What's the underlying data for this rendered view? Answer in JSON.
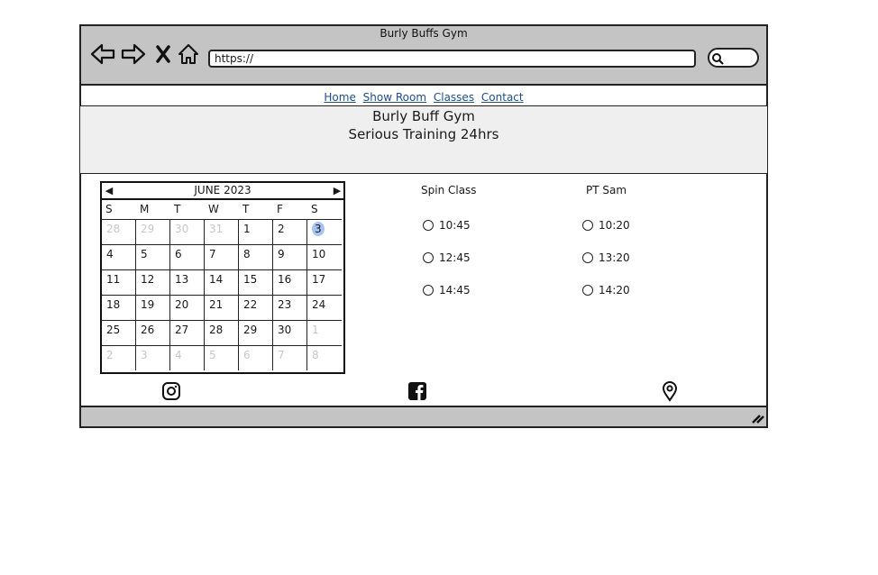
{
  "window": {
    "title": "Burly Buffs Gym"
  },
  "address_bar": {
    "value": "https://"
  },
  "nav": {
    "links": [
      "Home",
      "Show Room",
      "Classes",
      "Contact"
    ]
  },
  "hero": {
    "title": "Burly Buff Gym",
    "subtitle": "Serious Training 24hrs"
  },
  "calendar": {
    "month_label": "JUNE 2023",
    "weekdays": [
      "S",
      "M",
      "T",
      "W",
      "T",
      "F",
      "S"
    ],
    "selected_day": "3",
    "weeks": [
      [
        {
          "d": "28",
          "dim": true
        },
        {
          "d": "29",
          "dim": true
        },
        {
          "d": "30",
          "dim": true
        },
        {
          "d": "31",
          "dim": true
        },
        {
          "d": "1",
          "dim": false
        },
        {
          "d": "2",
          "dim": false
        },
        {
          "d": "3",
          "dim": false,
          "sel": true
        }
      ],
      [
        {
          "d": "4"
        },
        {
          "d": "5"
        },
        {
          "d": "6"
        },
        {
          "d": "7"
        },
        {
          "d": "8"
        },
        {
          "d": "9"
        },
        {
          "d": "10"
        }
      ],
      [
        {
          "d": "11"
        },
        {
          "d": "12"
        },
        {
          "d": "13"
        },
        {
          "d": "14"
        },
        {
          "d": "15"
        },
        {
          "d": "16"
        },
        {
          "d": "17"
        }
      ],
      [
        {
          "d": "18"
        },
        {
          "d": "19"
        },
        {
          "d": "20"
        },
        {
          "d": "21"
        },
        {
          "d": "22"
        },
        {
          "d": "23"
        },
        {
          "d": "24"
        }
      ],
      [
        {
          "d": "25"
        },
        {
          "d": "26"
        },
        {
          "d": "27"
        },
        {
          "d": "28"
        },
        {
          "d": "29"
        },
        {
          "d": "30"
        },
        {
          "d": "1",
          "dim": true
        }
      ],
      [
        {
          "d": "2",
          "dim": true
        },
        {
          "d": "3",
          "dim": true
        },
        {
          "d": "4",
          "dim": true
        },
        {
          "d": "5",
          "dim": true
        },
        {
          "d": "6",
          "dim": true
        },
        {
          "d": "7",
          "dim": true
        },
        {
          "d": "8",
          "dim": true
        }
      ]
    ]
  },
  "classes": [
    {
      "name": "Spin Class",
      "times": [
        "10:45",
        "12:45",
        "14:45"
      ]
    },
    {
      "name": "PT Sam",
      "times": [
        "10:20",
        "13:20",
        "14:20"
      ]
    }
  ],
  "footer": {
    "icons": [
      "instagram-icon",
      "facebook-icon",
      "location-pin-icon"
    ]
  },
  "colors": {
    "chrome": "#c4c4c4",
    "hero_bg": "#efefef",
    "link": "#1f4e8c",
    "selected_day": "#a8c3f0"
  }
}
